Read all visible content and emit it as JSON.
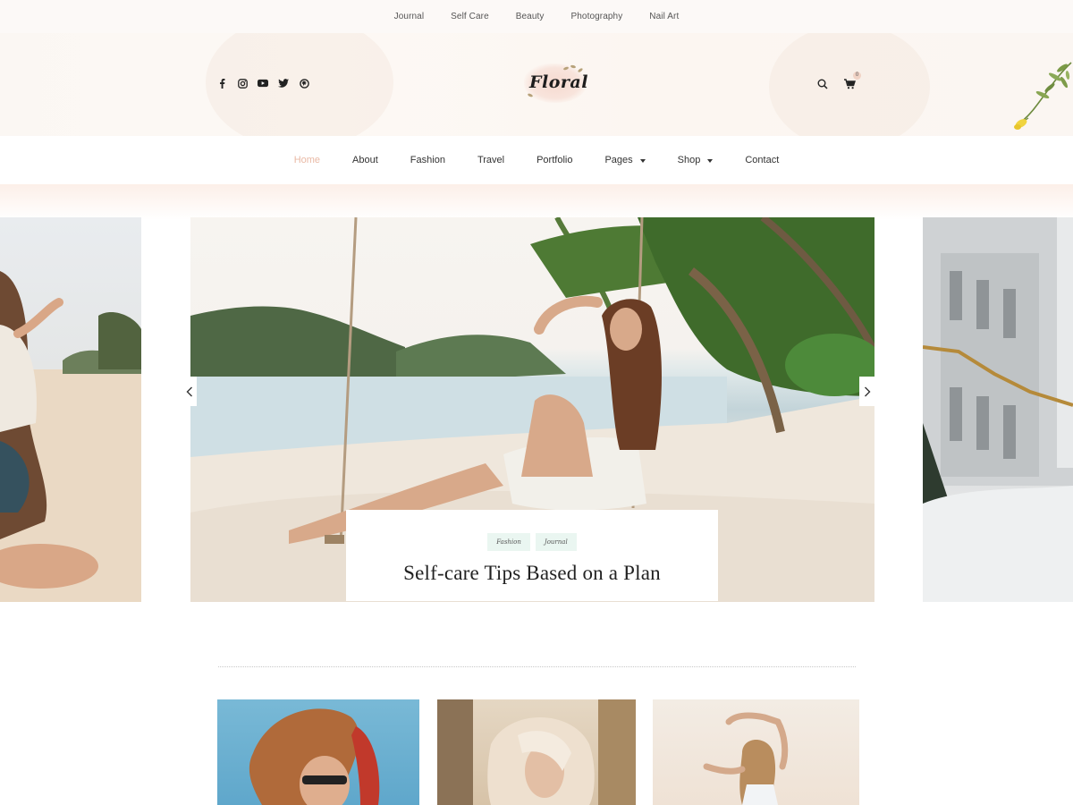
{
  "top_links": [
    "Journal",
    "Self Care",
    "Beauty",
    "Photography",
    "Nail Art"
  ],
  "header": {
    "logo_text": "Floral",
    "social_icons": [
      "facebook-icon",
      "instagram-icon",
      "youtube-icon",
      "twitter-icon",
      "pinterest-icon"
    ],
    "cart_count": "0"
  },
  "nav": {
    "items": [
      {
        "label": "Home",
        "active": true
      },
      {
        "label": "About"
      },
      {
        "label": "Fashion"
      },
      {
        "label": "Travel"
      },
      {
        "label": "Portfolio"
      },
      {
        "label": "Pages",
        "dropdown": true
      },
      {
        "label": "Shop",
        "dropdown": true
      },
      {
        "label": "Contact"
      }
    ]
  },
  "featured": {
    "tags": [
      "Fashion",
      "Journal"
    ],
    "title": "Self-care Tips Based on a Plan"
  },
  "colors": {
    "accent": "#e9b9a5",
    "tag_bg": "#eaf6f1",
    "top_bar_bg": "#fcf9f7"
  }
}
